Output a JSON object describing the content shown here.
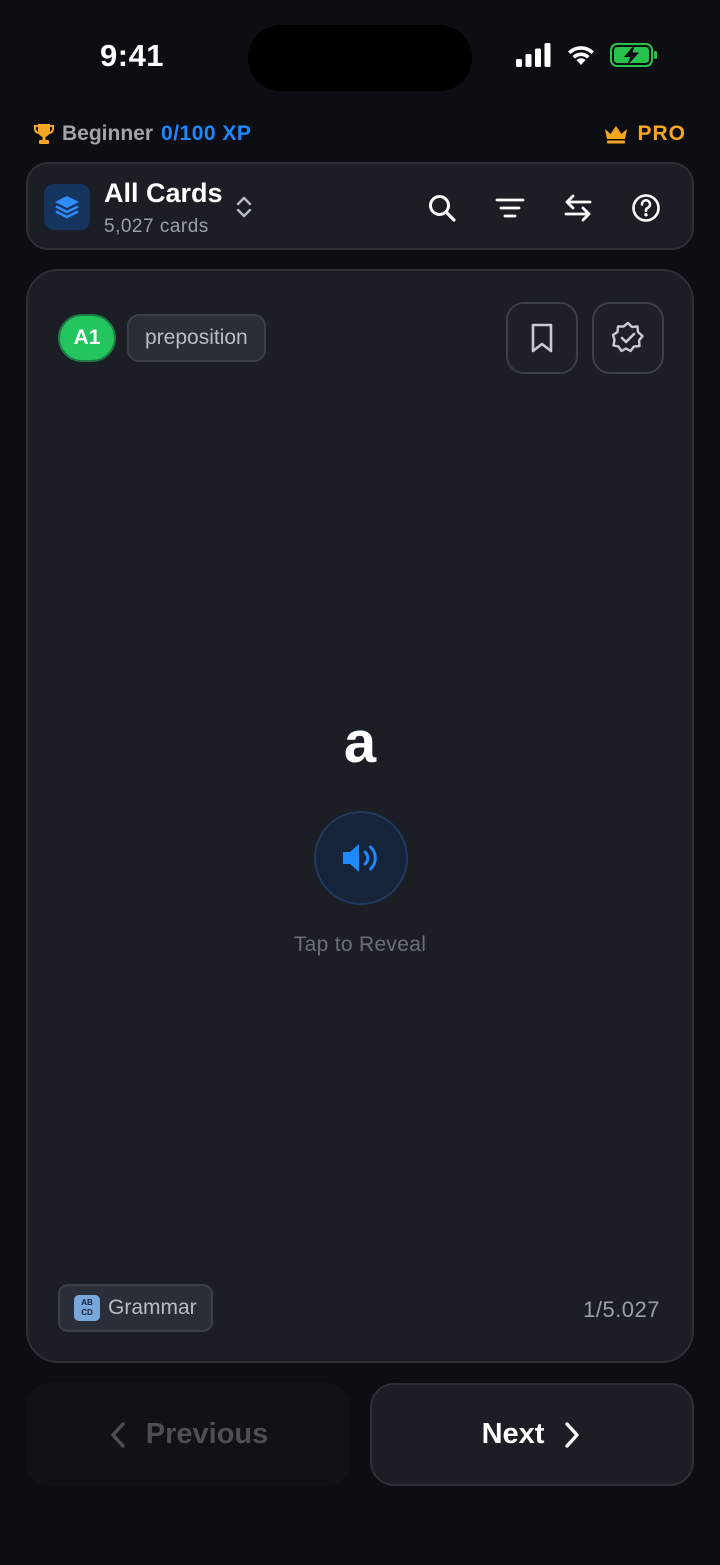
{
  "status_bar": {
    "time": "9:41"
  },
  "progress": {
    "level": "Beginner",
    "xp": "0/100 XP",
    "pro_label": "PRO"
  },
  "deck": {
    "title": "All Cards",
    "count": "5,027 cards"
  },
  "card": {
    "level": "A1",
    "part_of_speech": "preposition",
    "word": "a",
    "reveal_hint": "Tap to Reveal",
    "category": "Grammar",
    "counter": "1/5.027"
  },
  "nav": {
    "previous_label": "Previous",
    "next_label": "Next"
  },
  "colors": {
    "accent": "#1e88ff",
    "pro": "#f5a623",
    "level_badge": "#22c55e",
    "card_bg": "#1b1e24",
    "page_bg": "#0c0e13"
  },
  "icons": {
    "trophy": "trophy-icon",
    "crown": "crown-icon",
    "deck": "layers-icon",
    "search": "search-icon",
    "filter": "filter-icon",
    "swap": "swap-icon",
    "help": "help-icon",
    "bookmark": "bookmark-icon",
    "mastered": "badge-check-icon",
    "audio": "speaker-icon"
  }
}
